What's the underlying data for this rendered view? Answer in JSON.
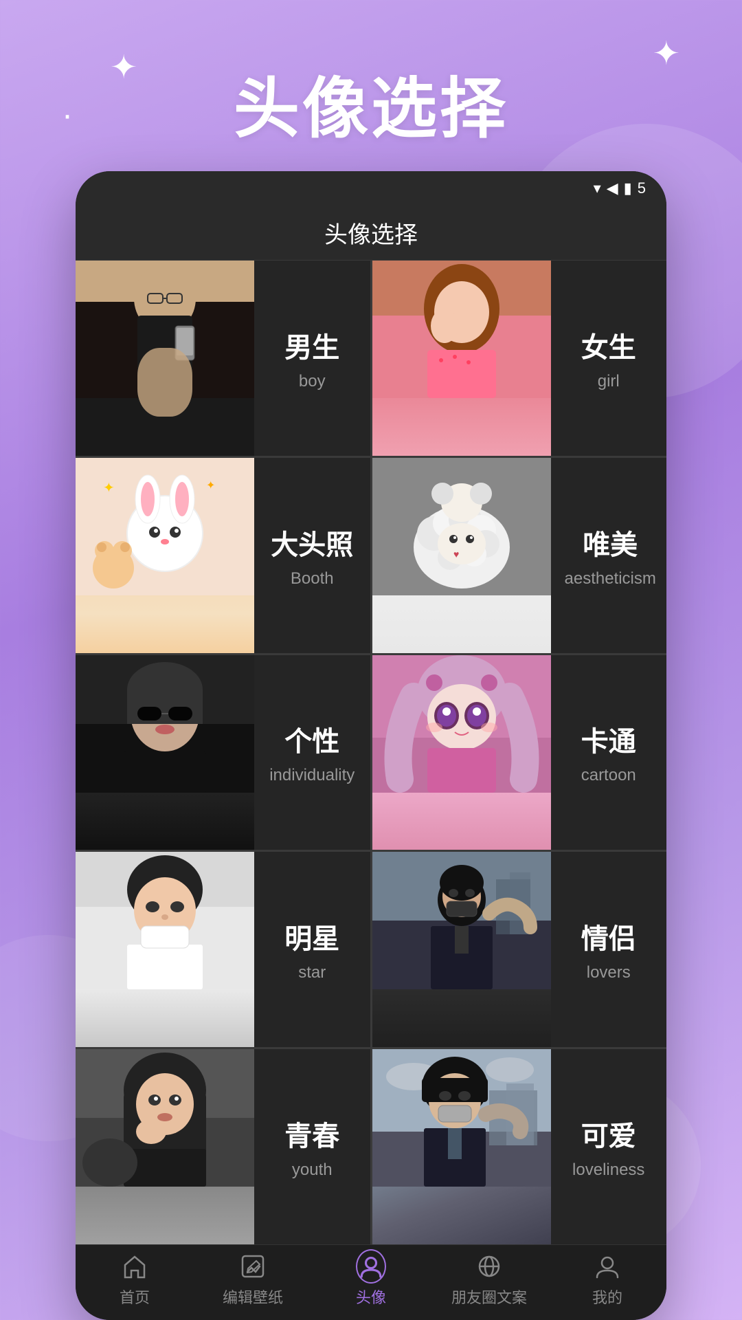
{
  "page": {
    "background_title": "头像选择",
    "app_title": "头像选择",
    "sparkles": [
      "✦",
      "✦",
      "✦"
    ]
  },
  "grid_items": [
    {
      "id": "boy",
      "title_zh": "男生",
      "title_en": "boy",
      "image_class": "img-boy",
      "position": "left"
    },
    {
      "id": "girl",
      "title_zh": "女生",
      "title_en": "girl",
      "image_class": "img-girl",
      "position": "right"
    },
    {
      "id": "booth",
      "title_zh": "大头照",
      "title_en": "Booth",
      "image_class": "img-booth",
      "position": "left"
    },
    {
      "id": "aestheticism",
      "title_zh": "唯美",
      "title_en": "aestheticism",
      "image_class": "img-aestheticism",
      "position": "right"
    },
    {
      "id": "individuality",
      "title_zh": "个性",
      "title_en": "individuality",
      "image_class": "img-individuality",
      "position": "left"
    },
    {
      "id": "cartoon",
      "title_zh": "卡通",
      "title_en": "cartoon",
      "image_class": "img-cartoon",
      "position": "right"
    },
    {
      "id": "star",
      "title_zh": "明星",
      "title_en": "star",
      "image_class": "img-star",
      "position": "left"
    },
    {
      "id": "lovers",
      "title_zh": "情侣",
      "title_en": "lovers",
      "image_class": "img-lovers",
      "position": "right"
    },
    {
      "id": "youth",
      "title_zh": "青春",
      "title_en": "youth",
      "image_class": "img-youth",
      "position": "left"
    },
    {
      "id": "loveliness",
      "title_zh": "可爱",
      "title_en": "loveliness",
      "image_class": "img-loveliness",
      "position": "right"
    }
  ],
  "nav_items": [
    {
      "id": "home",
      "label": "首页",
      "active": false
    },
    {
      "id": "edit_wallpaper",
      "label": "编辑壁纸",
      "active": false
    },
    {
      "id": "avatar",
      "label": "头像",
      "active": true
    },
    {
      "id": "moments",
      "label": "朋友圈文案",
      "active": false
    },
    {
      "id": "profile",
      "label": "我的",
      "active": false
    }
  ],
  "status_bar": {
    "battery": "5",
    "wifi": "▲"
  }
}
